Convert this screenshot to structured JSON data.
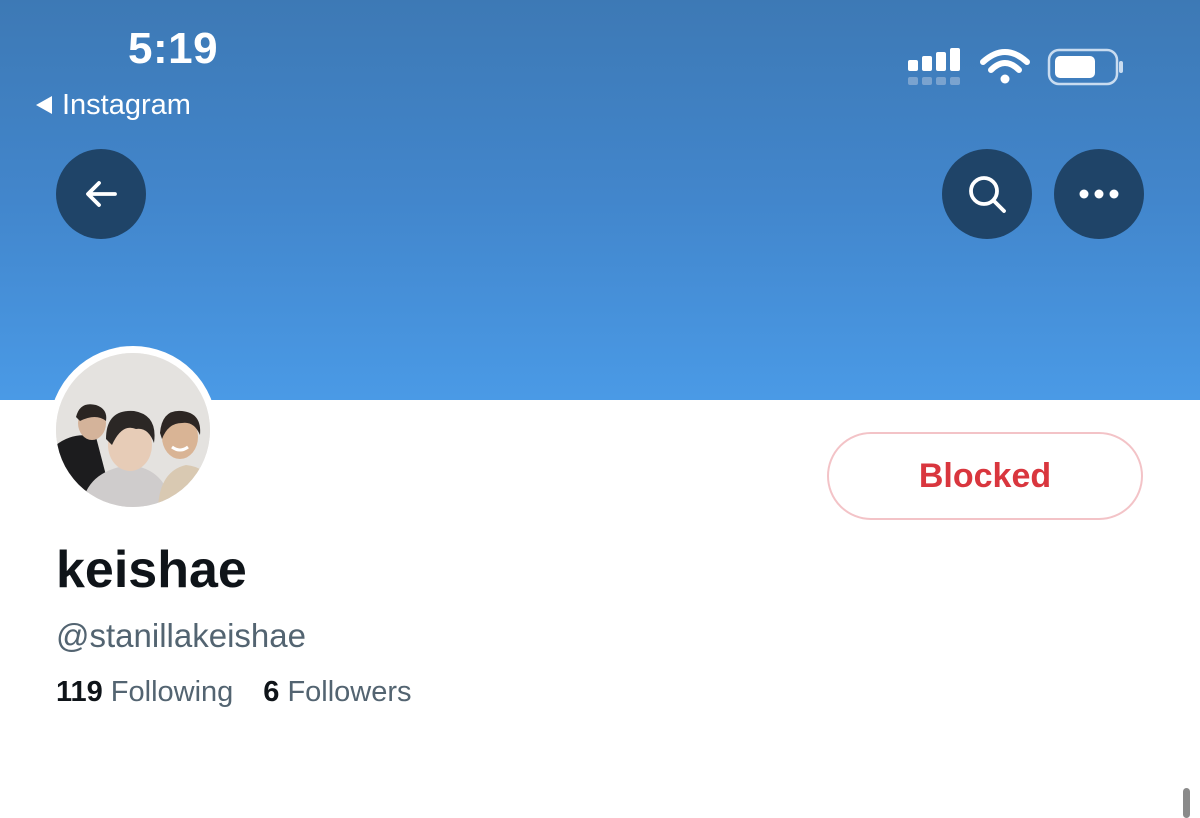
{
  "status_bar": {
    "time": "5:19",
    "back_app_label": "Instagram",
    "icons": [
      "cellular-signal-icon",
      "wifi-icon",
      "battery-icon"
    ]
  },
  "nav": {
    "back_icon": "arrow-left-icon",
    "search_icon": "search-icon",
    "more_icon": "more-horizontal-icon"
  },
  "profile": {
    "display_name": "keishae",
    "handle": "@stanillakeishae",
    "blocked_label": "Blocked",
    "following_count": "119",
    "following_label": "Following",
    "followers_count": "6",
    "followers_label": "Followers"
  },
  "colors": {
    "banner_top": "#3d79b5",
    "banner_bottom": "#4a9ae6",
    "nav_button": "#1f4468",
    "blocked_text": "#d9363e",
    "blocked_border": "#f3c3c7",
    "primary_text": "#0f1419",
    "secondary_text": "#536471"
  }
}
